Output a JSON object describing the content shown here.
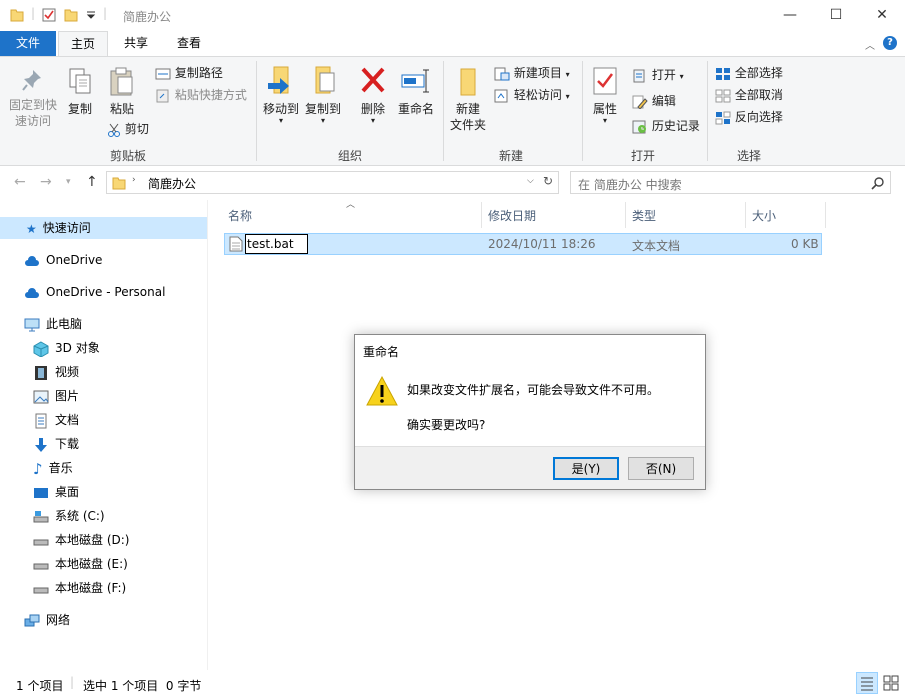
{
  "window": {
    "title": "简鹿办公",
    "controls": {
      "minimize": "—",
      "maximize": "☐",
      "close": "✕"
    }
  },
  "tabs": [
    {
      "label": "文件"
    },
    {
      "label": "主页"
    },
    {
      "label": "共享"
    },
    {
      "label": "查看"
    }
  ],
  "ribbon": {
    "clipboard": {
      "group": "剪贴板",
      "pin": "固定到快\n速访问",
      "copy": "复制",
      "paste": "粘贴",
      "copy_path": "复制路径",
      "paste_shortcut": "粘贴快捷方式",
      "cut": "剪切"
    },
    "organize": {
      "group": "组织",
      "move_to": "移动到",
      "copy_to": "复制到",
      "delete": "删除",
      "rename": "重命名"
    },
    "new": {
      "group": "新建",
      "new_folder": "新建\n文件夹",
      "new_item": "新建项目",
      "easy_access": "轻松访问"
    },
    "open": {
      "group": "打开",
      "properties": "属性",
      "open": "打开",
      "edit": "编辑",
      "history": "历史记录"
    },
    "select": {
      "group": "选择",
      "select_all": "全部选择",
      "select_none": "全部取消",
      "invert": "反向选择"
    }
  },
  "address": {
    "path": "简鹿办公",
    "search_placeholder": "在 简鹿办公 中搜索"
  },
  "navpane": {
    "quick_access": "快速访问",
    "onedrive": "OneDrive",
    "onedrive_personal": "OneDrive - Personal",
    "this_pc": "此电脑",
    "objects3d": "3D 对象",
    "videos": "视频",
    "pictures": "图片",
    "documents": "文档",
    "downloads": "下载",
    "music": "音乐",
    "desktop": "桌面",
    "drive_c": "系统 (C:)",
    "drive_d": "本地磁盘 (D:)",
    "drive_e": "本地磁盘 (E:)",
    "drive_f": "本地磁盘 (F:)",
    "network": "网络"
  },
  "columns": {
    "name": "名称",
    "modified": "修改日期",
    "type": "类型",
    "size": "大小"
  },
  "file": {
    "name": "test.bat",
    "modified": "2024/10/11 18:26",
    "type": "文本文档",
    "size": "0 KB"
  },
  "dialog": {
    "title": "重命名",
    "message": "如果改变文件扩展名，可能会导致文件不可用。",
    "question": "确实要更改吗?",
    "yes": "是(Y)",
    "no": "否(N)"
  },
  "status": {
    "count": "1 个项目",
    "selected": "选中 1 个项目  0 字节"
  },
  "colors": {
    "accent": "#1e73c9",
    "selection": "#cce8ff",
    "warning": "#f7d21c"
  }
}
